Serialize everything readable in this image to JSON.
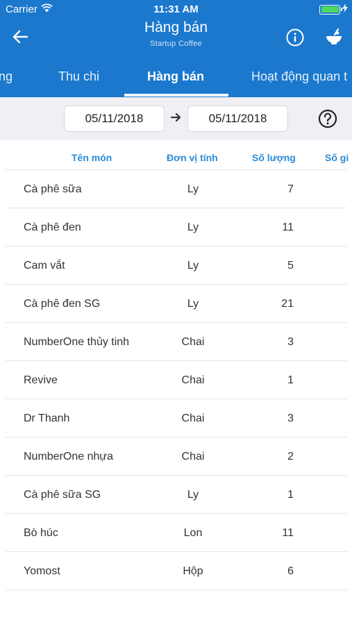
{
  "status_bar": {
    "carrier": "Carrier",
    "time": "11:31 AM"
  },
  "nav": {
    "title": "Hàng bán",
    "subtitle": "Startup Coffee"
  },
  "tabs": [
    {
      "label": "ng",
      "active": false
    },
    {
      "label": "Thu chi",
      "active": false
    },
    {
      "label": "Hàng bán",
      "active": true
    },
    {
      "label": "Hoạt động quan t",
      "active": false
    }
  ],
  "filter": {
    "date_from": "05/11/2018",
    "date_to": "05/11/2018"
  },
  "table": {
    "headers": {
      "name": "Tên món",
      "unit": "Đơn vị tính",
      "qty": "Số lượng",
      "more": "Số gi"
    },
    "rows": [
      {
        "name": "Cà phê sữa",
        "unit": "Ly",
        "qty": "7"
      },
      {
        "name": "Cà phê đen",
        "unit": "Ly",
        "qty": "11"
      },
      {
        "name": "Cam vắt",
        "unit": "Ly",
        "qty": "5"
      },
      {
        "name": "Cà phê đen SG",
        "unit": "Ly",
        "qty": "21"
      },
      {
        "name": "NumberOne thủy tinh",
        "unit": "Chai",
        "qty": "3"
      },
      {
        "name": "Revive",
        "unit": "Chai",
        "qty": "1"
      },
      {
        "name": "Dr Thanh",
        "unit": "Chai",
        "qty": "3"
      },
      {
        "name": "NumberOne nhựa",
        "unit": "Chai",
        "qty": "2"
      },
      {
        "name": "Cà phê sữa SG",
        "unit": "Ly",
        "qty": "1"
      },
      {
        "name": "Bò húc",
        "unit": "Lon",
        "qty": "11"
      },
      {
        "name": "Yomost",
        "unit": "Hộp",
        "qty": "6"
      }
    ]
  },
  "colors": {
    "header_bg": "#1b78cd",
    "header_text": "#ffffff",
    "column_header_text": "#2a8ad8",
    "battery_fill": "#4cd964",
    "filter_bg": "#efeff4"
  },
  "icons": [
    "wifi-icon",
    "battery-icon",
    "charging-icon",
    "back-arrow-icon",
    "info-icon",
    "bowl-icon",
    "arrow-right-icon",
    "help-icon"
  ]
}
